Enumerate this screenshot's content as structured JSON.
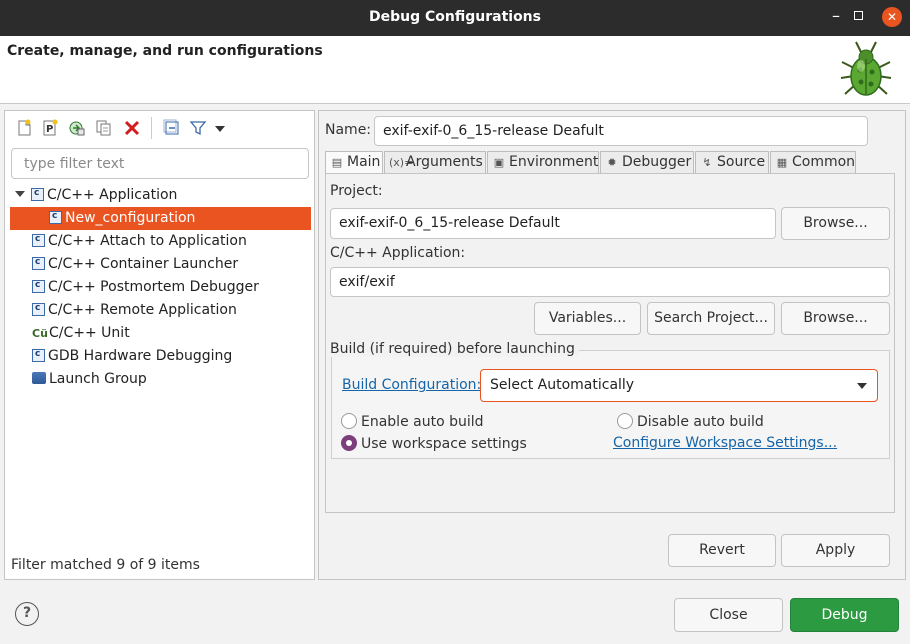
{
  "window": {
    "title": "Debug Configurations"
  },
  "header": {
    "title": "Create, manage, and run configurations"
  },
  "toolbar": {
    "icons": [
      "new-configuration-icon",
      "new-prototype-icon",
      "export-icon",
      "duplicate-icon",
      "delete-icon",
      "collapse-all-icon",
      "filter-icon",
      "view-menu-icon"
    ]
  },
  "filter": {
    "placeholder": "type filter text"
  },
  "tree": {
    "items": [
      {
        "label": "C/C++ Application",
        "expanded": true
      },
      {
        "label": "New_configuration",
        "selected": true
      },
      {
        "label": "C/C++ Attach to Application"
      },
      {
        "label": "C/C++ Container Launcher"
      },
      {
        "label": "C/C++ Postmortem Debugger"
      },
      {
        "label": "C/C++ Remote Application"
      },
      {
        "label": "C/C++ Unit"
      },
      {
        "label": "GDB Hardware Debugging"
      },
      {
        "label": "Launch Group"
      }
    ],
    "status": "Filter matched 9 of 9 items"
  },
  "config": {
    "name_label": "Name:",
    "name_value": "exif-exif-0_6_15-release Deafult",
    "tabs": [
      "Main",
      "Arguments",
      "Environment",
      "Debugger",
      "Source",
      "Common"
    ],
    "project_label": "Project:",
    "project_value": "exif-exif-0_6_15-release Default",
    "browse_label": "Browse...",
    "app_label": "C/C++ Application:",
    "app_value": "exif/exif",
    "variables_label": "Variables...",
    "search_project_label": "Search Project...",
    "browse2_label": "Browse...",
    "build_group_label": "Build (if required) before launching",
    "build_config_link": "Build Configuration:",
    "build_config_value": "Select Automatically",
    "enable_auto_build": "Enable auto build",
    "disable_auto_build": "Disable auto build",
    "use_workspace": "Use workspace settings",
    "configure_workspace_link": "Configure Workspace Settings...",
    "revert_label": "Revert",
    "apply_label": "Apply"
  },
  "footer": {
    "help": "?",
    "close_label": "Close",
    "debug_label": "Debug"
  },
  "colors": {
    "accent": "#e95420",
    "debug_button": "#2b9a41",
    "link": "#1565a8",
    "radio_on": "#7c3f7c"
  }
}
